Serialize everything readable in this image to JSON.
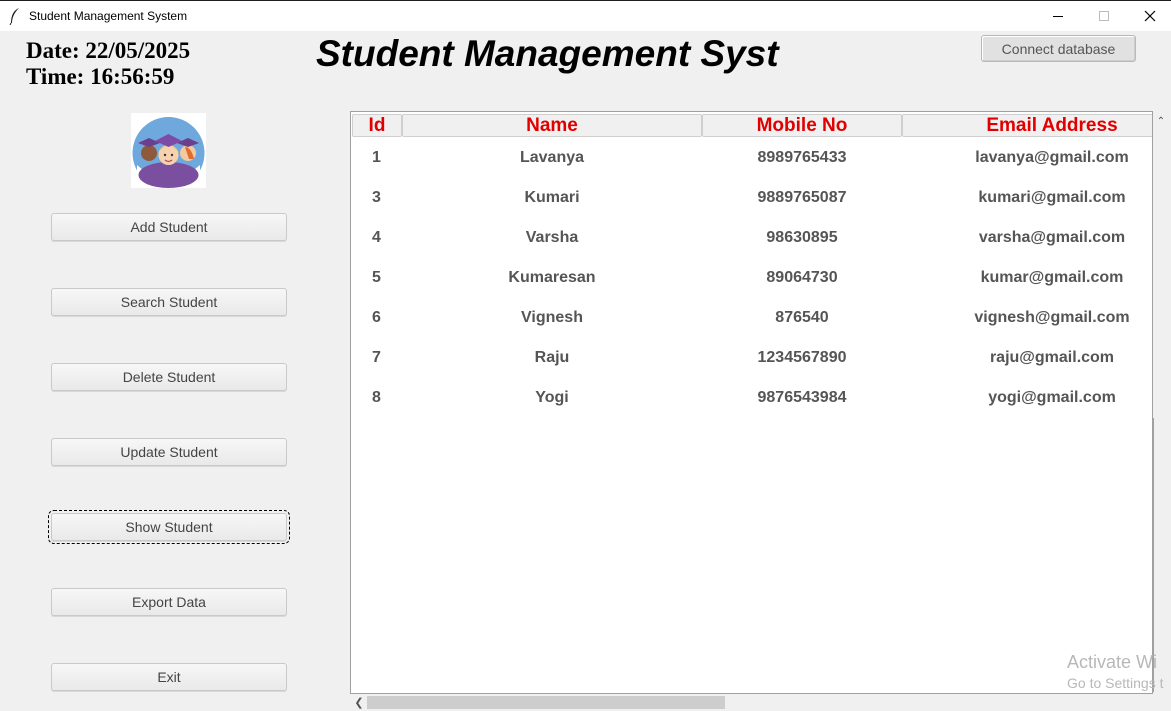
{
  "window": {
    "title": "Student Management System"
  },
  "header": {
    "date": "Date: 22/05/2025",
    "time": "Time: 16:56:59",
    "heading": "Student Management Syst",
    "connect_label": "Connect database"
  },
  "sidebar": {
    "buttons": [
      {
        "label": "Add Student"
      },
      {
        "label": "Search Student"
      },
      {
        "label": "Delete Student"
      },
      {
        "label": "Update Student"
      },
      {
        "label": "Show Student"
      },
      {
        "label": "Export Data"
      },
      {
        "label": "Exit"
      }
    ]
  },
  "table": {
    "columns": [
      "Id",
      "Name",
      "Mobile No",
      "Email Address"
    ],
    "rows": [
      {
        "id": "1",
        "name": "Lavanya",
        "mobile": "8989765433",
        "email": "lavanya@gmail.com"
      },
      {
        "id": "3",
        "name": "Kumari",
        "mobile": "9889765087",
        "email": "kumari@gmail.com"
      },
      {
        "id": "4",
        "name": "Varsha",
        "mobile": "98630895",
        "email": "varsha@gmail.com"
      },
      {
        "id": "5",
        "name": "Kumaresan",
        "mobile": "89064730",
        "email": "kumar@gmail.com"
      },
      {
        "id": "6",
        "name": "Vignesh",
        "mobile": "876540",
        "email": "vignesh@gmail.com"
      },
      {
        "id": "7",
        "name": "Raju",
        "mobile": "1234567890",
        "email": "raju@gmail.com"
      },
      {
        "id": "8",
        "name": "Yogi",
        "mobile": "9876543984",
        "email": "yogi@gmail.com"
      }
    ]
  },
  "watermark": {
    "line1": "Activate Wi",
    "line2": "Go to Settings t"
  },
  "colors": {
    "header_text": "#e00000",
    "background": "#f0f0f0"
  }
}
